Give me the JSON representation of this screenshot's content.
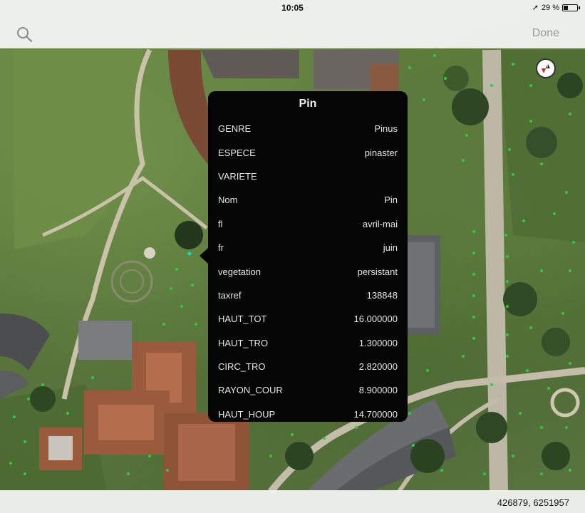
{
  "status_bar": {
    "time": "10:05",
    "location_arrow": "➚",
    "battery_text": "29 %"
  },
  "nav_bar": {
    "done_label": "Done",
    "search_icon": "search-icon"
  },
  "popup": {
    "title": "Pin",
    "attributes": [
      {
        "key": "GENRE",
        "value": "Pinus"
      },
      {
        "key": "ESPECE",
        "value": "pinaster"
      },
      {
        "key": "VARIETE",
        "value": ""
      },
      {
        "key": "Nom",
        "value": "Pin"
      },
      {
        "key": "fl",
        "value": "avril-mai"
      },
      {
        "key": "fr",
        "value": "juin"
      },
      {
        "key": "vegetation",
        "value": "persistant"
      },
      {
        "key": "taxref",
        "value": "138848"
      },
      {
        "key": "HAUT_TOT",
        "value": "16.000000"
      },
      {
        "key": "HAUT_TRO",
        "value": "1.300000"
      },
      {
        "key": "CIRC_TRO",
        "value": "2.820000"
      },
      {
        "key": "RAYON_COUR",
        "value": "8.900000"
      },
      {
        "key": "HAUT_HOUP",
        "value": "14.700000"
      }
    ]
  },
  "bottom_bar": {
    "coordinates": "426879, 6251957"
  },
  "compass": {
    "label": "N"
  },
  "colors": {
    "tree_point": "#2ecc40",
    "selected_point": "#00e5c0",
    "popup_background": "#050505",
    "roof": "#9a5a3c"
  }
}
